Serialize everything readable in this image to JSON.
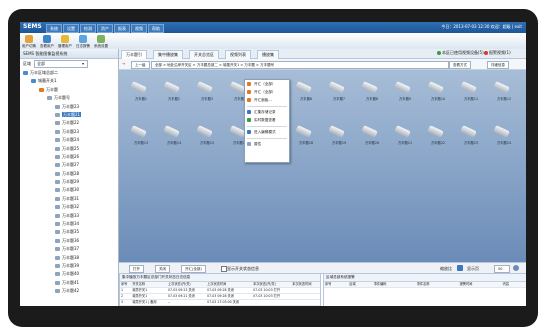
{
  "menubar": {
    "app_name": "SEMS",
    "menus": [
      "系统",
      "设置",
      "检测",
      "资产",
      "报表",
      "视频",
      "帮助"
    ],
    "info": "今日：2013-07-03 12:30  欢迎：超级 | exit"
  },
  "toolbar": {
    "buttons": [
      "用户切换",
      "查看用户",
      "管理用户",
      "日志报警",
      "系统设置"
    ]
  },
  "left": {
    "title": "SEMS 智能图像监视系统",
    "filter_label": "区域",
    "filter_value": "全部",
    "tree": [
      {
        "label": "万丰区域总部二",
        "level": 0,
        "sel": false
      },
      {
        "label": "城墨开关1",
        "level": 1,
        "sel": false
      },
      {
        "label": "万丰题",
        "level": 2,
        "sel": false
      },
      {
        "label": "万丰题号",
        "level": 3,
        "sel": false
      },
      {
        "label": "万丰题23",
        "level": 4,
        "sel": false
      },
      {
        "label": "万丰题21",
        "level": 4,
        "sel": true
      },
      {
        "label": "万丰题22",
        "level": 4,
        "sel": false
      },
      {
        "label": "万丰题23",
        "level": 4,
        "sel": false
      },
      {
        "label": "万丰题24",
        "level": 4,
        "sel": false
      },
      {
        "label": "万丰题25",
        "level": 4,
        "sel": false
      },
      {
        "label": "万丰题26",
        "level": 4,
        "sel": false
      },
      {
        "label": "万丰题27",
        "level": 4,
        "sel": false
      },
      {
        "label": "万丰题28",
        "level": 4,
        "sel": false
      },
      {
        "label": "万丰题29",
        "level": 4,
        "sel": false
      },
      {
        "label": "万丰题30",
        "level": 4,
        "sel": false
      },
      {
        "label": "万丰题31",
        "level": 4,
        "sel": false
      },
      {
        "label": "万丰题32",
        "level": 4,
        "sel": false
      },
      {
        "label": "万丰题33",
        "level": 4,
        "sel": false
      },
      {
        "label": "万丰题34",
        "level": 4,
        "sel": false
      },
      {
        "label": "万丰题35",
        "level": 4,
        "sel": false
      },
      {
        "label": "万丰题36",
        "level": 4,
        "sel": false
      },
      {
        "label": "万丰题37",
        "level": 4,
        "sel": false
      },
      {
        "label": "万丰题38",
        "level": 4,
        "sel": false
      },
      {
        "label": "万丰题39",
        "level": 4,
        "sel": false
      },
      {
        "label": "万丰题40",
        "level": 4,
        "sel": false
      },
      {
        "label": "万丰题41",
        "level": 4,
        "sel": false
      },
      {
        "label": "万丰题42",
        "level": 4,
        "sel": false
      }
    ]
  },
  "tabs": [
    "万丰题引",
    "集中播放集",
    "开关总览区",
    "视频列表",
    "播放集"
  ],
  "legend": {
    "normal": "本区已使用视频设备(5)",
    "alarm": "报警视频(1)"
  },
  "address": {
    "up": "上一级",
    "path": [
      "全部",
      "地处沿岸开关区",
      "万丰题总部二",
      "城墨开关1",
      "万丰题",
      "万丰题号"
    ],
    "search_btn": "查看方式",
    "detail_btn": "详细信息"
  },
  "cameras": [
    "万丰题1",
    "万丰题2",
    "万丰题3",
    "万丰题4",
    "万丰题5",
    "万丰题6",
    "万丰题7",
    "万丰题8",
    "万丰题9",
    "万丰题10",
    "万丰题11",
    "万丰题12",
    "万丰题13",
    "万丰题14",
    "万丰题15",
    "万丰题16",
    "万丰题17",
    "万丰题18",
    "万丰题19",
    "万丰题20",
    "万丰题21",
    "万丰题22",
    "万丰题23",
    "万丰题24"
  ],
  "context_menu": [
    "开汇（全部）",
    "开汇（全部）",
    "开汇面板...",
    "",
    "汇集存储记录",
    "实时数据查看",
    "",
    "进入编辑模式",
    "",
    "属性"
  ],
  "controls": {
    "buttons": [
      "打开",
      "关闭",
      "开汇(全部)"
    ],
    "checkbox_label": "显示开关状态信息",
    "zoom_label": "缩放比",
    "rows_label": "显示页",
    "rows_value": "50"
  },
  "log_panel": {
    "title": "集中播放万丰题区总部门开关状态日志信息",
    "headers": [
      "序号",
      "开关名称",
      "上次状态(开/关)",
      "上次状态时间",
      "本次状态(开/关)",
      "本次状态时间"
    ],
    "rows": [
      [
        "1",
        "城墨开关1",
        "07-03 09:23 关闭",
        "07-03 09:28 关闭",
        "07-03 10:03 打开",
        ""
      ],
      [
        "2",
        "城墨开关1",
        "07-03 09:21 关闭",
        "07-03 09:28 关闭",
        "07-03 10:03 打开",
        ""
      ],
      [
        "3",
        "城墨开关1 | 备用",
        "--",
        "07-03 17:03:00 关闭",
        "",
        ""
      ],
      [
        "4",
        "城墨开关1 | 备用",
        "--",
        "07-03 17:03:24 关闭",
        "",
        ""
      ]
    ]
  },
  "alarm_panel": {
    "title": "区域总部系统报警",
    "headers": [
      "序号",
      "区域",
      "事件编码",
      "事件名称",
      "报警时间",
      "内容"
    ],
    "rows": []
  }
}
